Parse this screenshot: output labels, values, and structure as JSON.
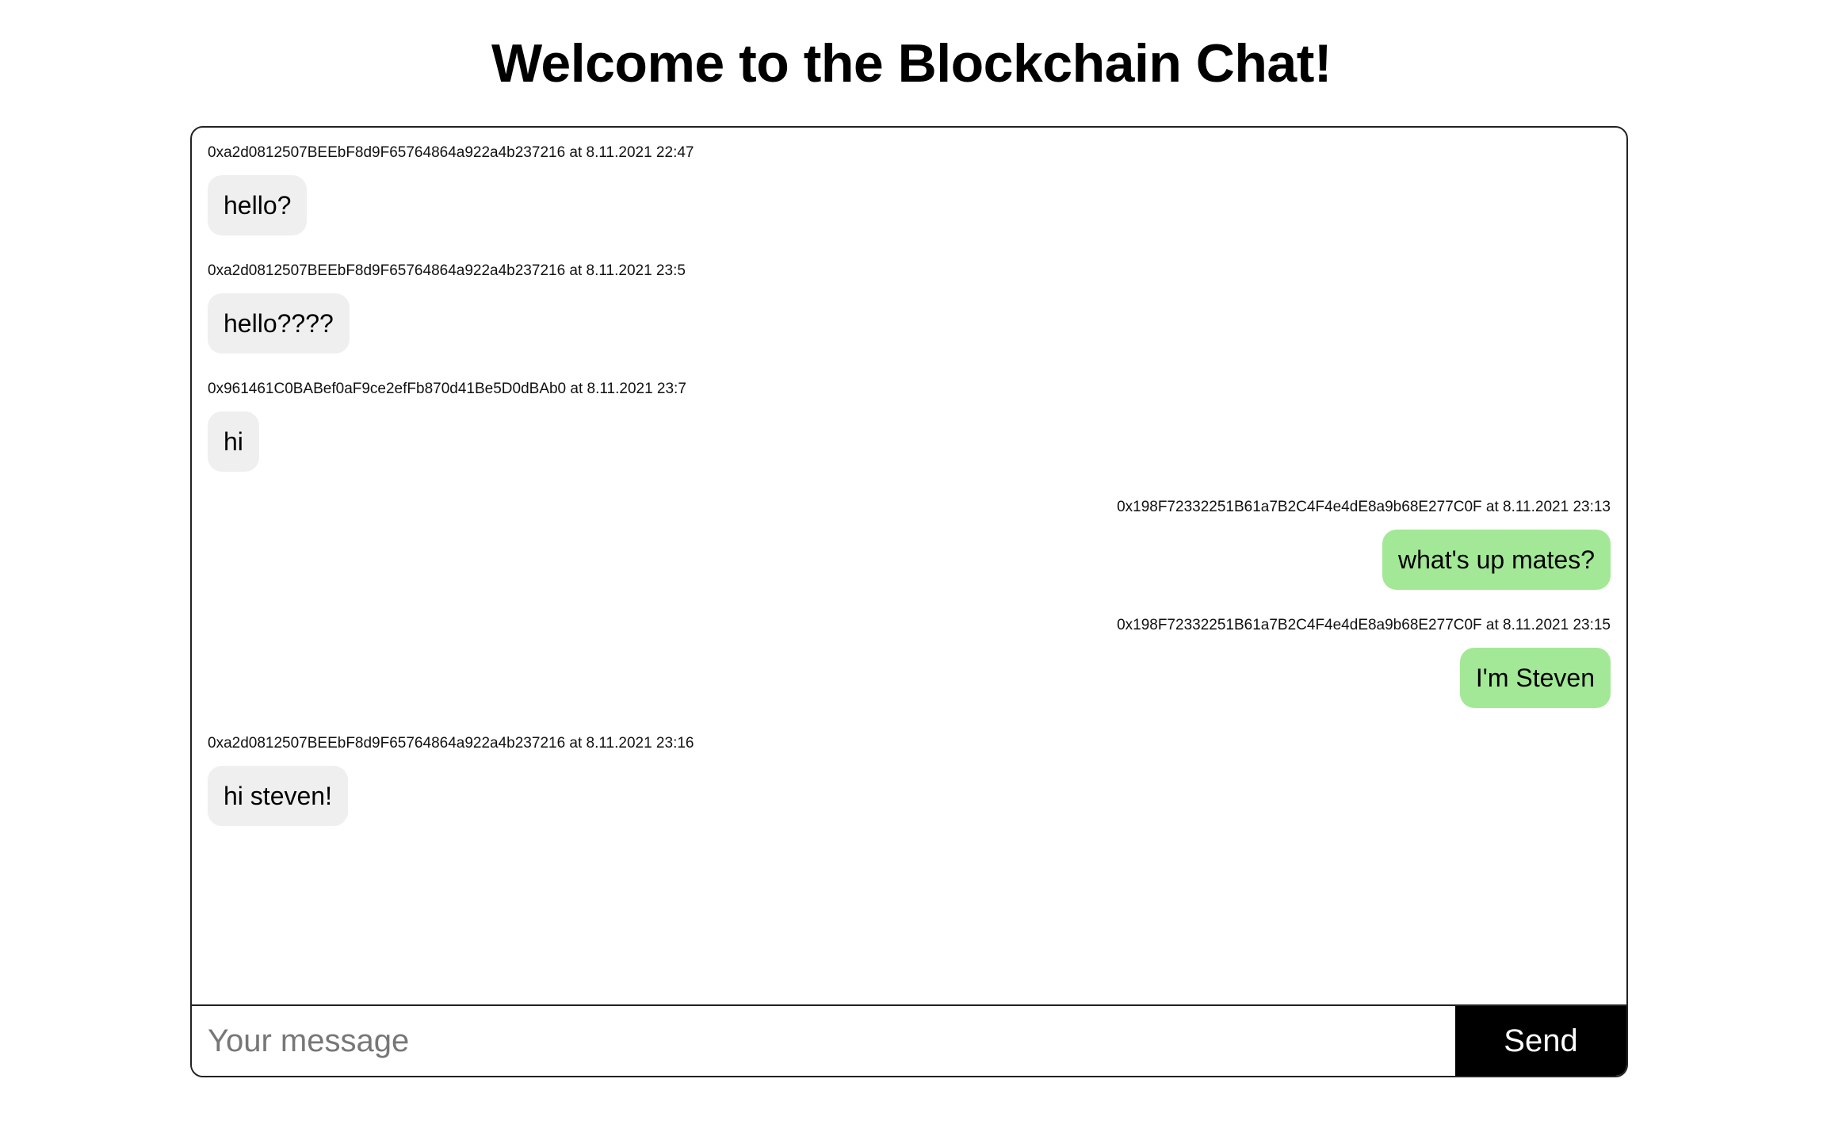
{
  "header": {
    "title": "Welcome to the Blockchain Chat!"
  },
  "messages": [
    {
      "sender": "0xa2d0812507BEEbF8d9F65764864a922a4b237216",
      "time": "8.11.2021 22:47",
      "meta": "0xa2d0812507BEEbF8d9F65764864a922a4b237216 at 8.11.2021 22:47",
      "text": "hello?",
      "mine": false
    },
    {
      "sender": "0xa2d0812507BEEbF8d9F65764864a922a4b237216",
      "time": "8.11.2021 23:5",
      "meta": "0xa2d0812507BEEbF8d9F65764864a922a4b237216 at 8.11.2021 23:5",
      "text": "hello????",
      "mine": false
    },
    {
      "sender": "0x961461C0BABef0aF9ce2efFb870d41Be5D0dBAb0",
      "time": "8.11.2021 23:7",
      "meta": "0x961461C0BABef0aF9ce2efFb870d41Be5D0dBAb0 at 8.11.2021 23:7",
      "text": "hi",
      "mine": false
    },
    {
      "sender": "0x198F72332251B61a7B2C4F4e4dE8a9b68E277C0F",
      "time": "8.11.2021 23:13",
      "meta": "0x198F72332251B61a7B2C4F4e4dE8a9b68E277C0F at 8.11.2021 23:13",
      "text": "what's up mates?",
      "mine": true
    },
    {
      "sender": "0x198F72332251B61a7B2C4F4e4dE8a9b68E277C0F",
      "time": "8.11.2021 23:15",
      "meta": "0x198F72332251B61a7B2C4F4e4dE8a9b68E277C0F at 8.11.2021 23:15",
      "text": "I'm Steven",
      "mine": true
    },
    {
      "sender": "0xa2d0812507BEEbF8d9F65764864a922a4b237216",
      "time": "8.11.2021 23:16",
      "meta": "0xa2d0812507BEEbF8d9F65764864a922a4b237216 at 8.11.2021 23:16",
      "text": "hi steven!",
      "mine": false
    }
  ],
  "composer": {
    "placeholder": "Your message",
    "value": "",
    "send_label": "Send"
  },
  "colors": {
    "own_bubble": "#a3e896",
    "other_bubble": "#efefef",
    "send_button": "#000000"
  }
}
